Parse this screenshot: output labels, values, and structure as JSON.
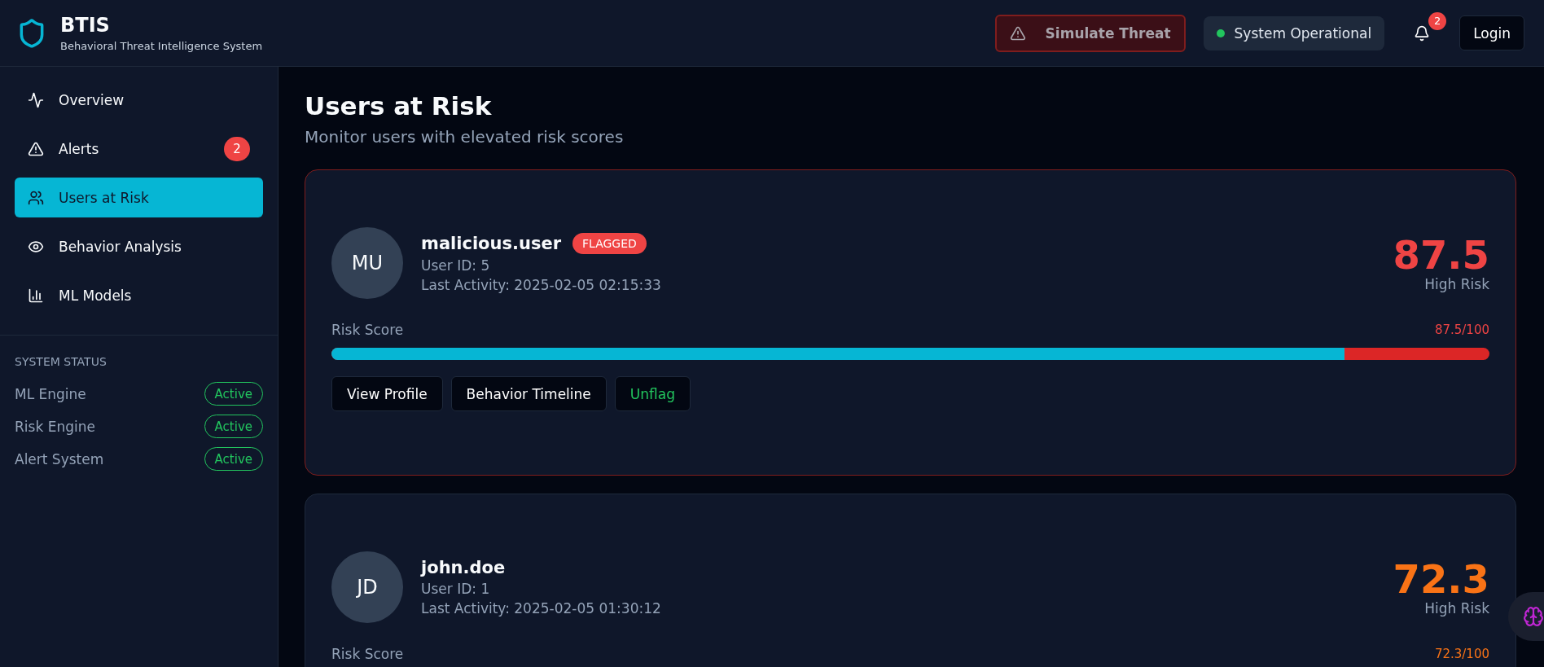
{
  "brand": {
    "title": "BTIS",
    "subtitle": "Behavioral Threat Intelligence System"
  },
  "header": {
    "simulate_button": "Simulate Threat",
    "status": {
      "label": "System Operational",
      "color": "#22c55e"
    },
    "notifications": "2",
    "login_button": "Login"
  },
  "sidebar": {
    "items": [
      {
        "label": "Overview",
        "selected": false
      },
      {
        "label": "Alerts",
        "selected": false,
        "badge": "2"
      },
      {
        "label": "Users at Risk",
        "selected": true
      },
      {
        "label": "Behavior Analysis",
        "selected": false
      },
      {
        "label": "ML Models",
        "selected": false
      }
    ],
    "status_heading": "SYSTEM STATUS",
    "status_rows": [
      {
        "name": "ML Engine",
        "state": "Active"
      },
      {
        "name": "Risk Engine",
        "state": "Active"
      },
      {
        "name": "Alert System",
        "state": "Active"
      }
    ]
  },
  "page": {
    "title": "Users at Risk",
    "subtitle": "Monitor users with elevated risk scores"
  },
  "users": [
    {
      "initials": "MU",
      "name": "malicious.user",
      "flagged": true,
      "flag_label": "FLAGGED",
      "user_id": "User ID: 5",
      "last_activity": "Last Activity: 2025-02-05 02:15:33",
      "score": "87.5",
      "color": "#ef4444",
      "risk_label": "High Risk",
      "score_caption": "Risk Score",
      "score_reading": "87.5/100",
      "level": 0.875,
      "buttons": [
        {
          "label": "View Profile",
          "kind": "plain"
        },
        {
          "label": "Behavior Timeline",
          "kind": "plain"
        },
        {
          "label": "Unflag",
          "kind": "success"
        }
      ]
    },
    {
      "initials": "JD",
      "name": "john.doe",
      "flagged": false,
      "user_id": "User ID: 1",
      "last_activity": "Last Activity: 2025-02-05 01:30:12",
      "score": "72.3",
      "color": "#f97316",
      "risk_label": "High Risk",
      "score_caption": "Risk Score",
      "score_reading": "72.3/100"
    }
  ]
}
